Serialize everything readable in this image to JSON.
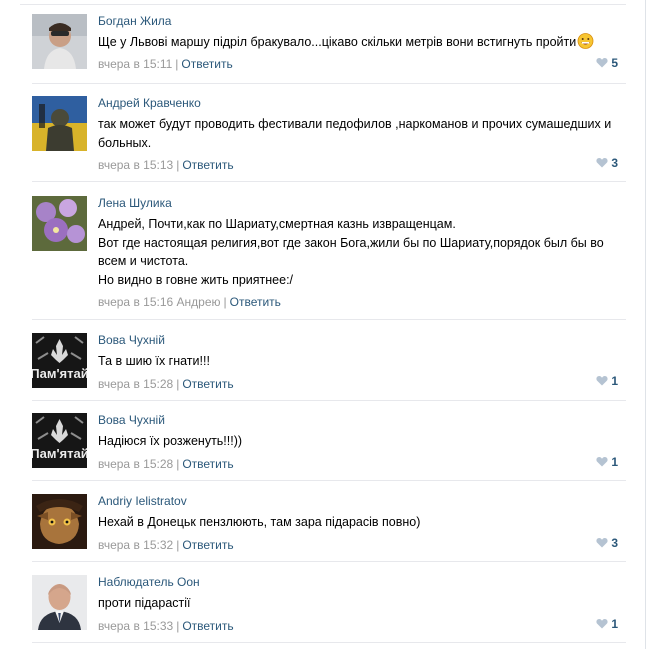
{
  "reply_label": "Ответить",
  "colors": {
    "link": "#2b587a",
    "meta": "#999999",
    "like": "#b5c3d2",
    "separator": "#e7e8ec"
  },
  "replies": [
    {
      "author": "Богдан Жила",
      "text": [
        "Ще у Львові маршу підріл бракувало...цікаво скільки метрів вони встигнуть пройти"
      ],
      "emoji": "grinning-face-emoji",
      "time": "вчера в 15:11",
      "likes": "5"
    },
    {
      "author": "Андрей Кравченко",
      "text": [
        "так может будут проводить фестивали педофилов ,наркоманов и прочих сумашедших и",
        "больных."
      ],
      "time": "вчера в 15:13",
      "likes": "3"
    },
    {
      "author": "Лена Шулика",
      "text": [
        "Андрей, Почти,как по Шариату,смертная казнь извращенцам.",
        "Вот где настоящая религия,вот где закон Бога,жили бы по Шариату,порядок был бы во",
        "всем и чистота.",
        "Но видно в говне жить приятнее:/"
      ],
      "time": "вчера в 15:16",
      "addressee": "Андрею",
      "likes": ""
    },
    {
      "author": "Вова Чухній",
      "text": [
        "Та в шию їх гнати!!!"
      ],
      "time": "вчера в 15:28",
      "likes": "1",
      "avatar_caption": "Пам'ятай"
    },
    {
      "author": "Вова Чухній",
      "text": [
        "Надіюся їх розженуть!!!))"
      ],
      "time": "вчера в 15:28",
      "likes": "1",
      "avatar_caption": "Пам'ятай"
    },
    {
      "author": "Andriy Ielistratov",
      "text": [
        "Нехай в Донецьк пензлюють, там зара підарасів повно)"
      ],
      "time": "вчера в 15:32",
      "likes": "3"
    },
    {
      "author": "Наблюдатель Оон",
      "text": [
        "проти підарастії"
      ],
      "time": "вчера в 15:33",
      "likes": "1"
    }
  ]
}
